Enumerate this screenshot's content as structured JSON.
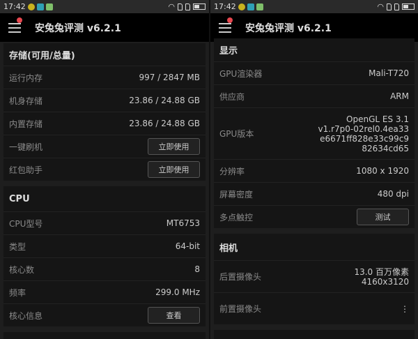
{
  "status": {
    "time": "17:42"
  },
  "app": {
    "title": "安兔兔评测 v6.2.1"
  },
  "left": {
    "storage": {
      "title": "存储(可用/总量)",
      "rows": [
        {
          "label": "运行内存",
          "value": "997 / 2847 MB"
        },
        {
          "label": "机身存储",
          "value": "23.86 / 24.88 GB"
        },
        {
          "label": "内置存储",
          "value": "23.86 / 24.88 GB"
        }
      ],
      "flash": {
        "label": "一键刷机",
        "button": "立即使用"
      },
      "redpacket": {
        "label": "红包助手",
        "button": "立即使用"
      }
    },
    "cpu": {
      "title": "CPU",
      "rows": [
        {
          "label": "CPU型号",
          "value": "MT6753"
        },
        {
          "label": "类型",
          "value": "64-bit"
        },
        {
          "label": "核心数",
          "value": "8"
        },
        {
          "label": "频率",
          "value": "299.0 MHz"
        }
      ],
      "core": {
        "label": "核心信息",
        "button": "查看"
      }
    }
  },
  "right": {
    "display": {
      "title": "显示",
      "rows": [
        {
          "label": "GPU渲染器",
          "value": "Mali-T720"
        },
        {
          "label": "供应商",
          "value": "ARM"
        }
      ],
      "gpu_version": {
        "label": "GPU版本",
        "lines": [
          "OpenGL ES 3.1",
          "v1.r7p0-02rel0.4ea33",
          "e6671ff828e33c99c9",
          "82634cd65"
        ]
      },
      "rows2": [
        {
          "label": "分辨率",
          "value": "1080 x 1920"
        },
        {
          "label": "屏幕密度",
          "value": "480 dpi"
        }
      ],
      "touch": {
        "label": "多点触控",
        "button": "测试"
      }
    },
    "camera": {
      "title": "相机",
      "rear": {
        "label": "后置摄像头",
        "lines": [
          "13.0 百万像素",
          "4160x3120"
        ]
      },
      "front": {
        "label": "前置摄像头",
        "value": "⋮"
      }
    }
  }
}
